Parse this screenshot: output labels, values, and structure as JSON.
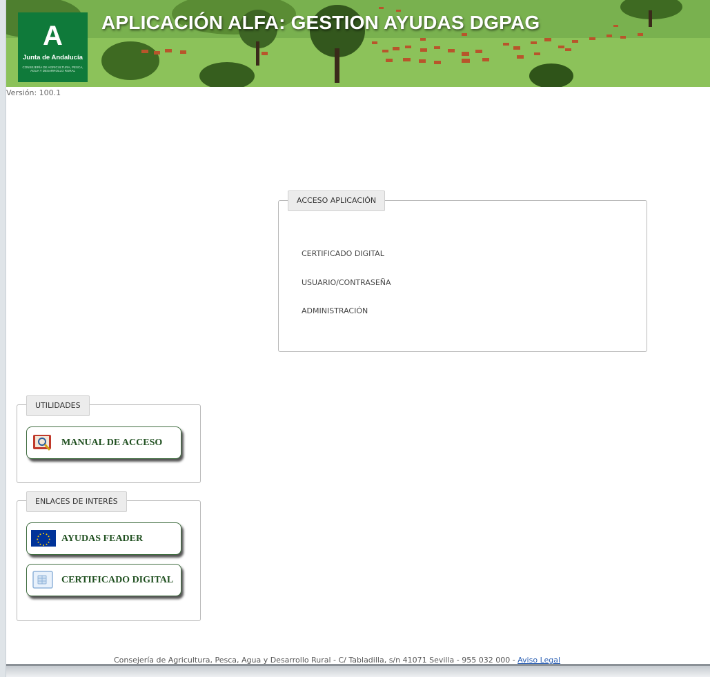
{
  "header": {
    "title": "APLICACIÓN ALFA: GESTION AYUDAS DGPAG",
    "logo": {
      "mark": "A",
      "name": "Junta de Andalucía",
      "subtitle": "CONSEJERÍA DE AGRICULTURA, PESCA, AGUA Y DESARROLLO RURAL"
    }
  },
  "version_label": "Versión: 100.1",
  "access": {
    "legend": "ACCESO APLICACIÓN",
    "links": [
      "CERTIFICADO DIGITAL",
      "USUARIO/CONTRASEÑA",
      "ADMINISTRACIÓN"
    ]
  },
  "utilities": {
    "legend": "UTILIDADES",
    "buttons": [
      {
        "label": "MANUAL DE ACCESO",
        "icon": "manual-book-icon"
      }
    ]
  },
  "links_of_interest": {
    "legend": "ENLACES DE INTERÉS",
    "buttons": [
      {
        "label": "AYUDAS FEADER",
        "icon": "eu-flag-icon"
      },
      {
        "label": "CERTIFICADO DIGITAL",
        "icon": "digital-certificate-icon"
      }
    ]
  },
  "footer": {
    "text": "Consejería de Agricultura, Pesca, Agua y Desarrollo Rural - C/ Tabladilla, s/n 41071 Sevilla - 955 032 000 - ",
    "legal_link": "Aviso Legal"
  },
  "colors": {
    "logo_green": "#0f7a3a",
    "button_text": "#1f4f1f",
    "link_blue": "#2b5fb3",
    "eu_blue": "#003399",
    "eu_gold": "#ffcc00"
  }
}
